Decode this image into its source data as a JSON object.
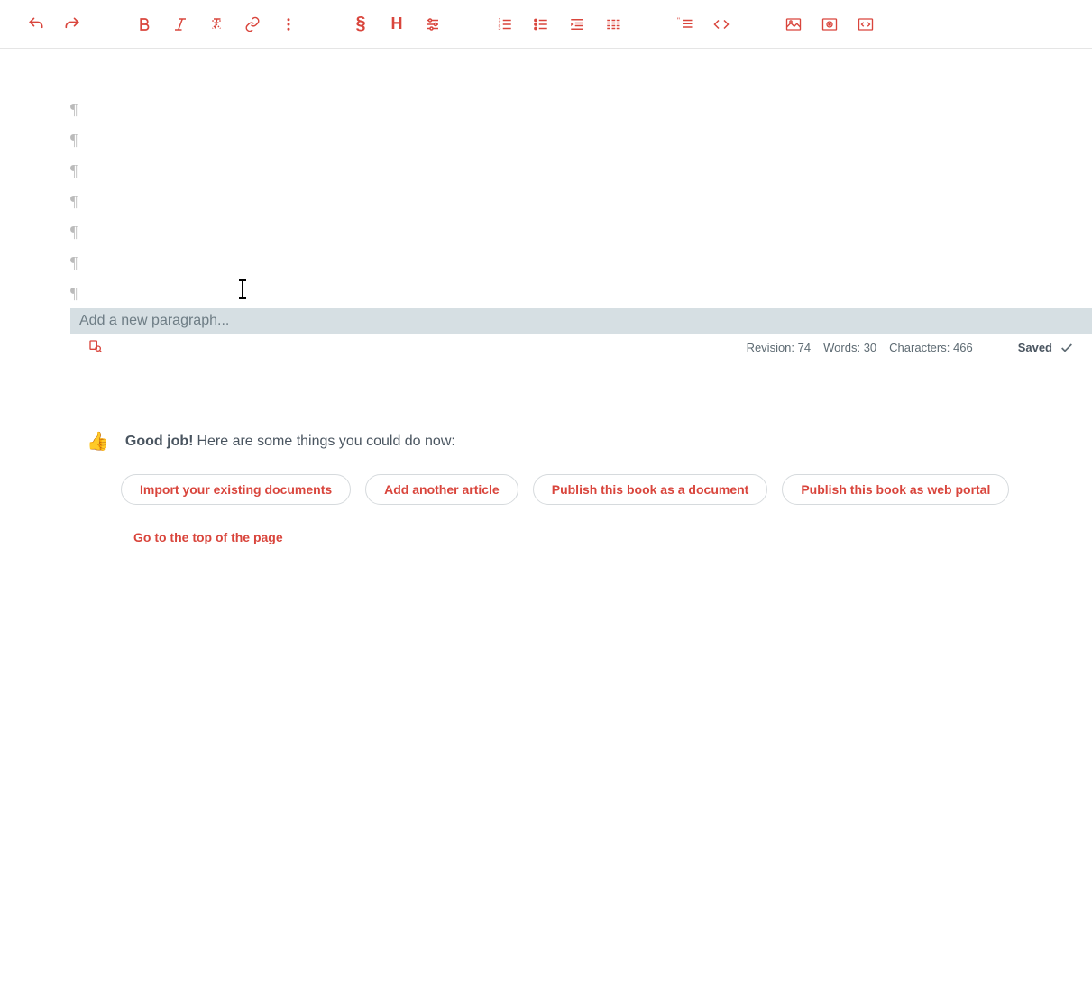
{
  "toolbar": {
    "undo": "undo",
    "redo": "redo",
    "bold": "bold",
    "italic": "italic",
    "clearfmt": "clear-formatting",
    "link": "link",
    "more": "more",
    "section": "section",
    "heading": "heading",
    "sliders": "format-options",
    "list_ol": "ordered-list",
    "list_ul": "unordered-list",
    "indent": "indent",
    "columns": "columns",
    "quote": "quote",
    "code": "code",
    "image": "image",
    "video": "video",
    "embed": "embed-code"
  },
  "editor": {
    "placeholder": "Add a new paragraph...",
    "paragraph_count": 7
  },
  "status": {
    "revision_label": "Revision:",
    "revision_value": "74",
    "words_label": "Words:",
    "words_value": "30",
    "chars_label": "Characters:",
    "chars_value": "466",
    "saved_label": "Saved"
  },
  "suggest": {
    "bold": "Good job!",
    "rest": "Here are some things you could do now:",
    "actions": [
      "Import your existing documents",
      "Add another article",
      "Publish this book as a document",
      "Publish this book as web portal"
    ],
    "top_link": "Go to the top of the page"
  }
}
